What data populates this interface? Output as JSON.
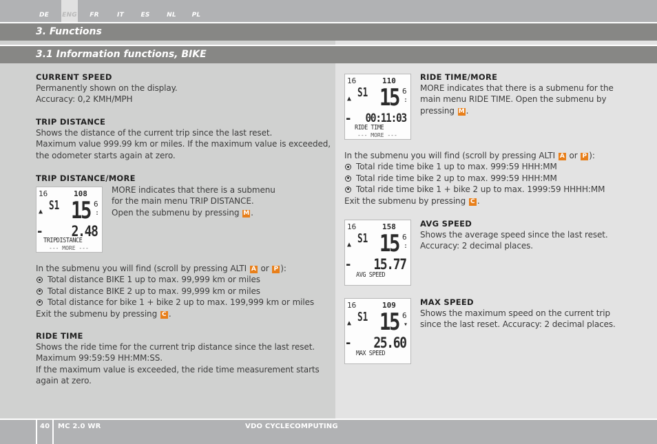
{
  "languages": [
    {
      "code": "DE",
      "active": false
    },
    {
      "code": "ENG",
      "active": true
    },
    {
      "code": "FR",
      "active": false
    },
    {
      "code": "IT",
      "active": false
    },
    {
      "code": "ES",
      "active": false
    },
    {
      "code": "NL",
      "active": false
    },
    {
      "code": "PL",
      "active": false
    }
  ],
  "chapter_title": "3.  Functions",
  "section_title": "3.1  Information functions, BIKE",
  "colors": {
    "key_badge": "#e87f1a",
    "section_bar": "#878785",
    "top_bar": "#b1b2b4"
  },
  "keys": {
    "A": "A",
    "P": "P",
    "M": "M",
    "C": "C"
  },
  "left": {
    "current_speed": {
      "heading": "CURRENT SPEED",
      "lines": [
        "Permanently shown on the display.",
        "Accuracy: 0,2 KMH/MPH"
      ]
    },
    "trip_distance": {
      "heading": "TRIP DISTANCE",
      "lines": [
        "Shows the distance of the current trip since the last reset.",
        "Maximum value 999.99 km or miles. If the maximum value is exceeded,",
        "the odometer starts again at zero."
      ]
    },
    "trip_distance_more": {
      "heading": "TRIP DISTANCE/MORE",
      "lines": [
        "MORE indicates that there is a submenu",
        "for the main menu TRIP DISTANCE."
      ],
      "press_text": "Open the submenu by pressing",
      "display": {
        "top_left": "16",
        "top_right": "108",
        "speed": "15",
        "speed_decimal": "6",
        "value": "2.48",
        "label": "TRIPDISTANCE",
        "sub_label": "--- MORE ---"
      }
    },
    "submenu": {
      "intro_prefix": "In the submenu you will find (scroll by pressing ALTI",
      "intro_or": "or",
      "intro_suffix": "):",
      "items": [
        "Total distance BIKE 1 up to max. 99,999 km or miles",
        "Total distance BIKE 2 up to max. 99,999 km or miles",
        "Total distance for bike 1 + bike 2 up to max. 199,999 km or miles"
      ],
      "exit_text": "Exit the submenu by pressing"
    },
    "ride_time": {
      "heading": "RIDE TIME",
      "lines": [
        "Shows the ride time for the current trip distance since the last reset.",
        "Maximum 99:59:59 HH:MM:SS.",
        "If the maximum value is exceeded, the ride time measurement starts",
        "again at zero."
      ]
    }
  },
  "right": {
    "ride_time_more": {
      "heading": "RIDE TIME/MORE",
      "lines": [
        "MORE indicates that there is a submenu for the",
        "main menu RIDE TIME. Open the submenu by"
      ],
      "press_text": "pressing",
      "display": {
        "top_left": "16",
        "top_right": "110",
        "speed": "15",
        "speed_decimal": "6",
        "value": "00:11:03",
        "label": "RIDE TIME",
        "sub_label": "--- MORE ---"
      }
    },
    "submenu": {
      "intro_prefix": "In the submenu you will find (scroll by pressing ALTI",
      "intro_or": "or",
      "intro_suffix": "):",
      "items": [
        "Total ride time bike 1 up to max. 999:59 HHH:MM",
        "Total ride time bike 2 up to max. 999:59 HHH:MM",
        "Total ride time bike 1 + bike 2 up to max. 1999:59 HHHH:MM"
      ],
      "exit_text": "Exit the submenu by pressing"
    },
    "avg_speed": {
      "heading": "AVG SPEED",
      "lines": [
        "Shows the average speed since the last reset.",
        "Accuracy: 2 decimal places."
      ],
      "display": {
        "top_left": "16",
        "top_right": "158",
        "speed": "15",
        "speed_decimal": "6",
        "value": "15.77",
        "label": "AVG SPEED"
      }
    },
    "max_speed": {
      "heading": "MAX SPEED",
      "lines": [
        "Shows the maximum speed on the current trip",
        "since the last reset. Accuracy: 2 decimal places."
      ],
      "display": {
        "top_left": "16",
        "top_right": "109",
        "speed": "15",
        "speed_decimal": "6",
        "value": "25.60",
        "label": "MAX SPEED"
      }
    }
  },
  "footer": {
    "page_number": "40",
    "model": "MC 2.0 WR",
    "brand": "VDO CYCLECOMPUTING"
  }
}
